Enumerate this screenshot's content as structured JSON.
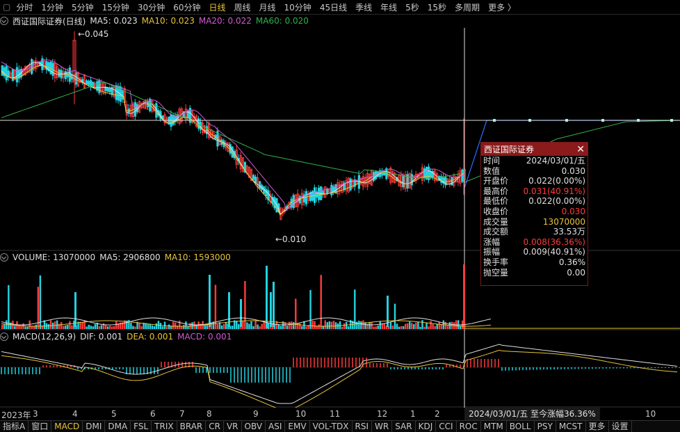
{
  "periods": [
    "分时",
    "1分钟",
    "5分钟",
    "15分钟",
    "30分钟",
    "60分钟",
    "日线",
    "周线",
    "月线",
    "10分钟",
    "45日线",
    "季线",
    "年线",
    "5秒",
    "15秒",
    "多周期",
    "更多 〉"
  ],
  "active_period": "日线",
  "price_header": {
    "name": "西证国际证券(日线)",
    "ma5": "MA5: 0.023",
    "ma10": "MA10: 0.023",
    "ma20": "MA20: 0.022",
    "ma60": "MA60: 0.020"
  },
  "price_labels": {
    "high": "0.045",
    "low": "0.010"
  },
  "volume_header": {
    "vol": "VOLUME: 13070000",
    "ma5": "MA5: 2906800",
    "ma10": "MA10: 1593000"
  },
  "macd_header": {
    "title": "MACD(12,26,9)",
    "dif": "DIF: 0.001",
    "dea": "DEA: 0.001",
    "macd": "MACD: 0.001"
  },
  "x_axis": [
    "2023年",
    "3",
    "4",
    "5",
    "6",
    "7",
    "8",
    "9",
    "10",
    "11",
    "12",
    "1",
    "2",
    "10"
  ],
  "crosshair_info": "2024/03/01/五   至今涨幅36.36%",
  "popup": {
    "title": "西证国际证券",
    "rows": [
      {
        "k": "时间",
        "v": "2024/03/01/五",
        "c": ""
      },
      {
        "k": "数值",
        "v": "0.030",
        "c": ""
      },
      {
        "k": "开盘价",
        "v": "0.022(0.00%)",
        "c": ""
      },
      {
        "k": "最高价",
        "v": "0.031(40.91%)",
        "c": "red"
      },
      {
        "k": "最低价",
        "v": "0.022(0.00%)",
        "c": ""
      },
      {
        "k": "收盘价",
        "v": "0.030",
        "c": "red"
      },
      {
        "k": "成交量",
        "v": "13070000",
        "c": "yel"
      },
      {
        "k": "成交额",
        "v": "33.53万",
        "c": ""
      },
      {
        "k": "涨幅",
        "v": "0.008(36.36%)",
        "c": "red"
      },
      {
        "k": "振幅",
        "v": "0.009(40.91%)",
        "c": ""
      },
      {
        "k": "换手率",
        "v": "0.36%",
        "c": ""
      },
      {
        "k": "抛空量",
        "v": "0.00",
        "c": ""
      }
    ]
  },
  "indicators": [
    "指标A",
    "窗口",
    "MACD",
    "DMI",
    "DMA",
    "FSL",
    "TRIX",
    "BRAR",
    "CR",
    "VR",
    "OBV",
    "ASI",
    "EMV",
    "VOL-TDX",
    "RSI",
    "WR",
    "SAR",
    "KDJ",
    "CCI",
    "ROC",
    "MTM",
    "BOLL",
    "PSY",
    "MCST",
    "更多",
    "设置"
  ],
  "active_indicator": "MACD",
  "colors": {
    "up": "#ff3b3b",
    "down": "#22d3e0",
    "ma5": "#e0e0e0",
    "ma10": "#e8c33a",
    "ma20": "#d35ad3",
    "ma60": "#2fb34b",
    "accent": "#8b1a1a"
  }
}
